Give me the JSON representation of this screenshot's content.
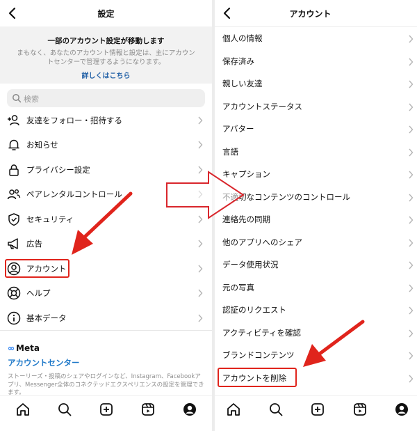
{
  "left": {
    "header": {
      "title": "設定"
    },
    "notice": {
      "title": "一部のアカウント設定が移動します",
      "body": "まもなく、あなたのアカウント情報と設定は、主にアカウントセンターで管理するようになります。",
      "link": "詳しくはこちら"
    },
    "search": {
      "placeholder": "検索"
    },
    "items": [
      {
        "label": "友達をフォロー・招待する",
        "icon": "add-person-icon"
      },
      {
        "label": "お知らせ",
        "icon": "bell-icon"
      },
      {
        "label": "プライバシー設定",
        "icon": "lock-icon"
      },
      {
        "label": "ペアレンタルコントロール",
        "icon": "people-icon"
      },
      {
        "label": "セキュリティ",
        "icon": "shield-icon"
      },
      {
        "label": "広告",
        "icon": "megaphone-icon"
      },
      {
        "label": "アカウント",
        "icon": "user-circle-icon"
      },
      {
        "label": "ヘルプ",
        "icon": "lifebuoy-icon"
      },
      {
        "label": "基本データ",
        "icon": "info-icon"
      }
    ],
    "meta": {
      "logo": "Meta",
      "account_center": "アカウントセンター",
      "footnote": "ストーリーズ・投稿のシェアやログインなど、Instagram、Facebookアプリ、Messenger全体のコネクテッドエクスペリエンスの設定を管理できます。"
    }
  },
  "right": {
    "header": {
      "title": "アカウント"
    },
    "items": [
      "個人の情報",
      "保存済み",
      "親しい友達",
      "アカウントステータス",
      "アバター",
      "言語",
      "キャプション",
      "不適切なコンテンツのコントロール",
      "連絡先の同期",
      "他のアプリへのシェア",
      "データ使用状況",
      "元の写真",
      "認証のリクエスト",
      "アクティビティを確認",
      "ブランドコンテンツ",
      "アカウントを削除"
    ]
  },
  "bottom_nav": [
    "home-icon",
    "search-icon",
    "create-icon",
    "reels-icon",
    "profile-icon"
  ],
  "colors": {
    "highlight": "#e0241c",
    "link_blue": "#1e78c8",
    "meta_blue": "#1877f2"
  }
}
